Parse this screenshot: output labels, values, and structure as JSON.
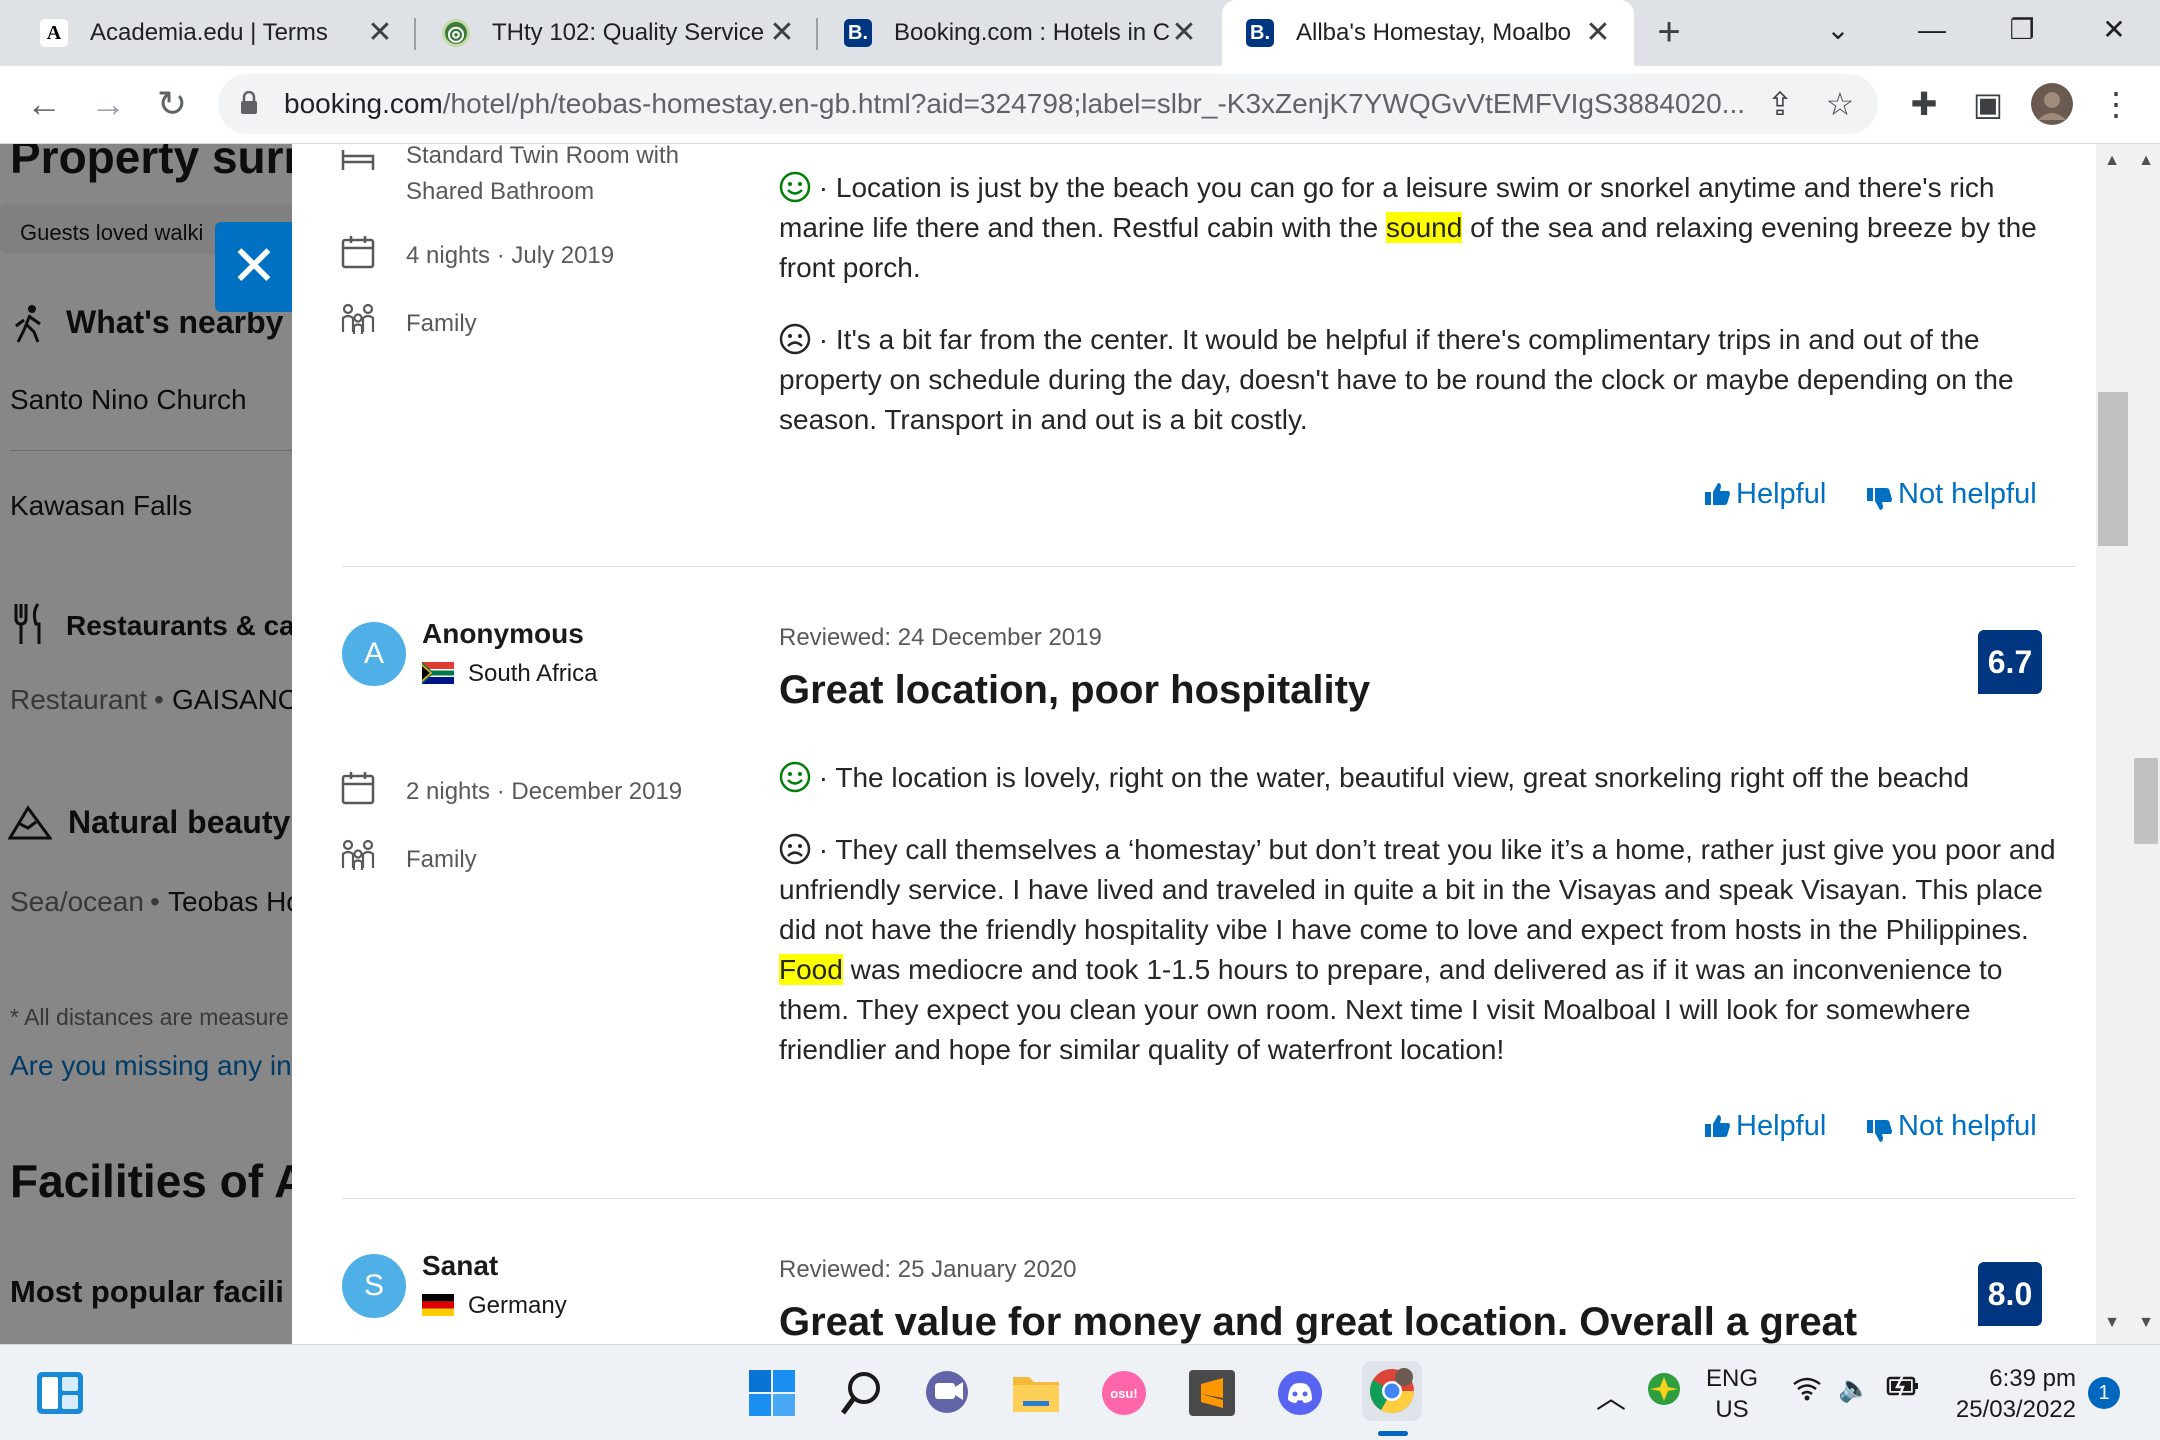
{
  "browser": {
    "tabs": [
      {
        "title": "Academia.edu | Terms",
        "favicon": "A"
      },
      {
        "title": "THty 102: Quality Service",
        "favicon": "globe-seal"
      },
      {
        "title": "Booking.com : Hotels in C",
        "favicon": "B."
      },
      {
        "title": "Allba's Homestay, Moalbo",
        "favicon": "B.",
        "active": true
      }
    ],
    "url_host": "booking.com",
    "url_path": "/hotel/ph/teobas-homestay.en-gb.html?aid=324798;label=slbr_-K3xZenjK7YWQGvVtEMFVIgS3884020..."
  },
  "background_page": {
    "property_heading": "Property surr",
    "guests_loved": "Guests loved walki",
    "whats_nearby": "What's nearby",
    "nearby_1": "Santo Nino Church",
    "nearby_2": "Kawasan Falls",
    "restaurants": "Restaurants & ca",
    "restaurant_type": "Restaurant",
    "restaurant_name": "GAISANO",
    "natural_beauty": "Natural beauty",
    "nature_type": "Sea/ocean",
    "nature_name": "Teobas Ho",
    "distances_note": "* All distances are measure",
    "missing_info": "Are you missing any in",
    "facilities_heading": "Facilities of A",
    "popular_facilities": "Most popular facili"
  },
  "reviews": {
    "first": {
      "room_type": "Standard Twin Room with Shared Bathroom",
      "stay_nights": "4 nights",
      "stay_date": "July 2019",
      "traveler_type": "Family",
      "positive_before": "· Location is just by the beach you can go for a leisure swim or snorkel anytime and there's rich marine life there and then. Restful cabin with the ",
      "positive_highlight": "sound",
      "positive_after": " of the sea and relaxing evening breeze by the front porch.",
      "negative": "· It's a bit far from the center. It would be helpful if there's complimentary trips in and out of the property on schedule during the day, doesn't have to be round the clock or maybe depending on the season. Transport in and out is a bit costly.",
      "helpful_label": "Helpful",
      "not_helpful_label": "Not helpful"
    },
    "second": {
      "avatar_letter": "A",
      "name": "Anonymous",
      "country": "South Africa",
      "stay_nights": "2 nights",
      "stay_date": "December 2019",
      "traveler_type": "Family",
      "reviewed": "Reviewed: 24 December 2019",
      "title": "Great location, poor hospitality",
      "score": "6.7",
      "positive": "· The location is lovely, right on the water, beautiful view, great snorkeling right off the beachd",
      "negative_before": "· They call themselves a ‘homestay’ but don’t treat you like it’s a home, rather just give you poor and unfriendly service. I have lived and traveled in quite a bit in the Visayas and speak Visayan. This place did not have the friendly hospitality vibe I have come to love and expect from hosts in the Philippines. ",
      "negative_highlight": "Food",
      "negative_after": " was mediocre and took 1-1.5 hours to prepare, and delivered as if it was an inconvenience to them. They expect you clean your own room. Next time I visit Moalboal I will look for somewhere friendlier and hope for similar quality of waterfront location!",
      "helpful_label": "Helpful",
      "not_helpful_label": "Not helpful"
    },
    "third": {
      "avatar_letter": "S",
      "name": "Sanat",
      "country": "Germany",
      "reviewed": "Reviewed: 25 January 2020",
      "title": "Great value for money and great location. Overall a great",
      "score": "8.0"
    }
  },
  "taskbar": {
    "language_line1": "ENG",
    "language_line2": "US",
    "time": "6:39 pm",
    "date": "25/03/2022",
    "notification_count": "1"
  },
  "colors": {
    "brand_blue": "#003580",
    "link_blue": "#0071c2",
    "highlight": "#feff00",
    "positive_green": "#008009"
  }
}
